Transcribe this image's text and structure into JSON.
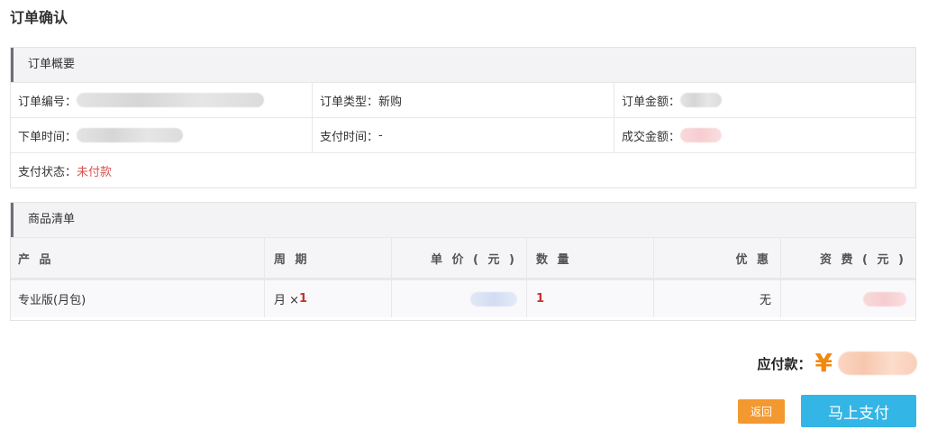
{
  "page": {
    "title": "订单确认"
  },
  "summary": {
    "heading": "订单概要",
    "order_no_label": "订单编号：",
    "order_type_label": "订单类型：",
    "order_type_value": "新购",
    "order_amount_label": "订单金额：",
    "order_time_label": "下单时间：",
    "pay_time_label": "支付时间：",
    "pay_time_value": "-",
    "deal_amount_label": "成交金额：",
    "pay_status_label": "支付状态：",
    "pay_status_value": "未付款",
    "status_color": "#d9534f"
  },
  "products": {
    "heading": "商品清单",
    "columns": [
      "产 品",
      "周 期",
      "单 价 ( 元 )",
      "数 量",
      "优 惠",
      "资 费 ( 元 )"
    ],
    "rows": [
      {
        "product": "专业版(月包)",
        "period_unit": "月 ×",
        "period_count": "1",
        "quantity": "1",
        "discount": "无"
      }
    ]
  },
  "footer": {
    "total_label": "应付款：",
    "currency_symbol": "¥",
    "back_button": "返回",
    "pay_button": "马上支付",
    "accent_colors": {
      "pay": "#33b5e5",
      "back": "#f3992f",
      "currency": "#f0890f"
    }
  }
}
